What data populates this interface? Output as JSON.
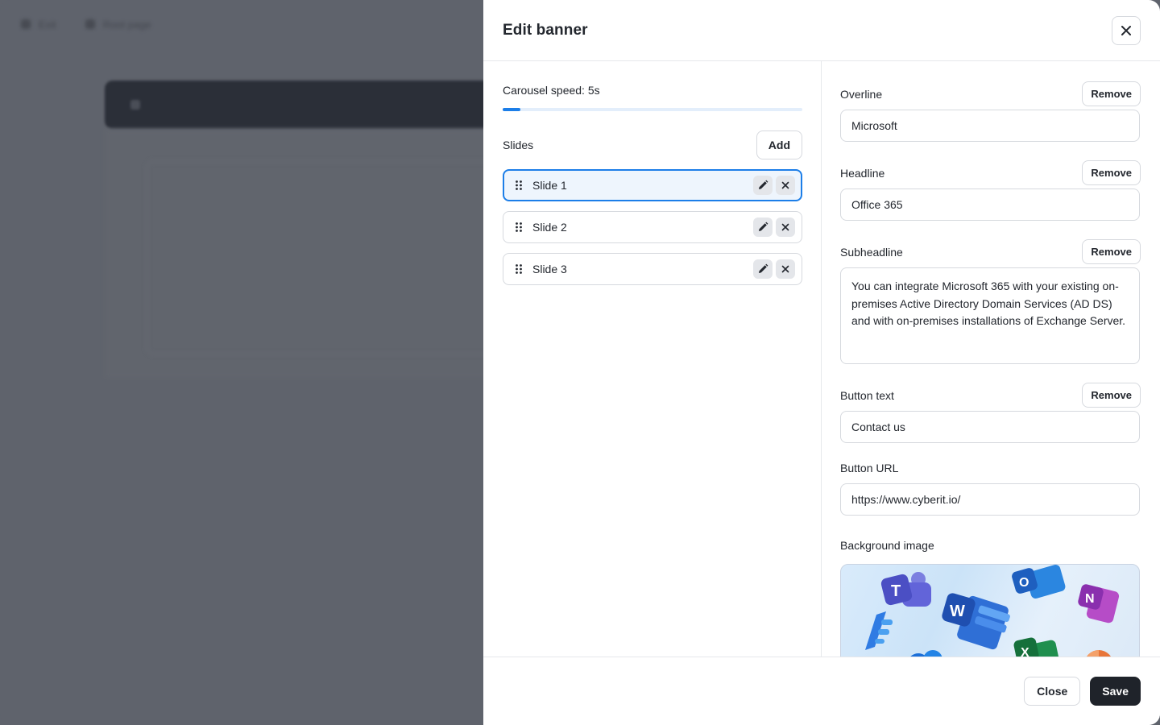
{
  "background": {
    "topbar_items": [
      "Exit",
      "Root page"
    ]
  },
  "drawer": {
    "title": "Edit banner",
    "close_icon": "close-icon"
  },
  "carousel": {
    "speed_label": "Carousel speed: 5s",
    "speed_fraction": 0.06
  },
  "slides": {
    "label": "Slides",
    "add_label": "Add",
    "items": [
      {
        "label": "Slide 1",
        "selected": true
      },
      {
        "label": "Slide 2",
        "selected": false
      },
      {
        "label": "Slide 3",
        "selected": false
      }
    ]
  },
  "fields": {
    "remove_label": "Remove",
    "overline": {
      "label": "Overline",
      "value": "Microsoft"
    },
    "headline": {
      "label": "Headline",
      "value": "Office 365"
    },
    "subheadline": {
      "label": "Subheadline",
      "value": "You can integrate Microsoft 365 with your existing on-premises Active Directory Domain Services (AD DS) and with on-premises installations of Exchange Server."
    },
    "button_text": {
      "label": "Button text",
      "value": "Contact us"
    },
    "button_url": {
      "label": "Button URL",
      "value": "https://www.cyberit.io/"
    },
    "background_image": {
      "label": "Background image"
    }
  },
  "image_icons": {
    "teams": "T",
    "word": "W",
    "outlook": "O",
    "onenote": "N",
    "excel": "X"
  },
  "footer": {
    "close_label": "Close",
    "save_label": "Save"
  },
  "colors": {
    "accent": "#1c7ee8",
    "primary_button": "#1f232a",
    "overlay": "#5f636c"
  }
}
